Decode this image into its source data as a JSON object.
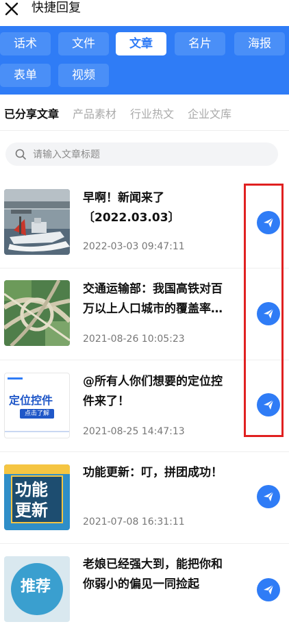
{
  "window": {
    "title": "快捷回复"
  },
  "tabs": [
    {
      "label": "话术"
    },
    {
      "label": "文件"
    },
    {
      "label": "文章"
    },
    {
      "label": "名片"
    },
    {
      "label": "海报"
    },
    {
      "label": "表单"
    },
    {
      "label": "视频"
    }
  ],
  "active_tab": "文章",
  "subtabs": [
    {
      "label": "已分享文章"
    },
    {
      "label": "产品素材"
    },
    {
      "label": "行业热文"
    },
    {
      "label": "企业文库"
    }
  ],
  "search": {
    "placeholder": "请输入文章标题"
  },
  "articles": [
    {
      "title_line1": "早啊！新闻来了",
      "title_line2": "〔2022.03.03〕",
      "date": "2022-03-03 09:47:11"
    },
    {
      "title_line1": "交通运输部：我国高铁对百",
      "title_line2": "万以上人口城市的覆盖率…",
      "date": "2021-08-26 10:05:23"
    },
    {
      "title_line1": "@所有人你们想要的定位控",
      "title_line2": "件来了！",
      "date": "2021-08-25 14:47:13",
      "thumb_text": "定位控件",
      "thumb_button": "点击了解"
    },
    {
      "title_line1": "功能更新：叮，拼团成功！",
      "title_line2": "",
      "date": "2021-07-08 16:31:11",
      "thumb_text1": "功能",
      "thumb_text2": "更新"
    },
    {
      "title_line1": "老娘已经强大到，能把你和",
      "title_line2": "你弱小的偏见一同捡起",
      "date": "",
      "thumb_text": "推荐"
    }
  ],
  "colors": {
    "accent": "#2f7cf6",
    "highlight": "#e02020"
  }
}
